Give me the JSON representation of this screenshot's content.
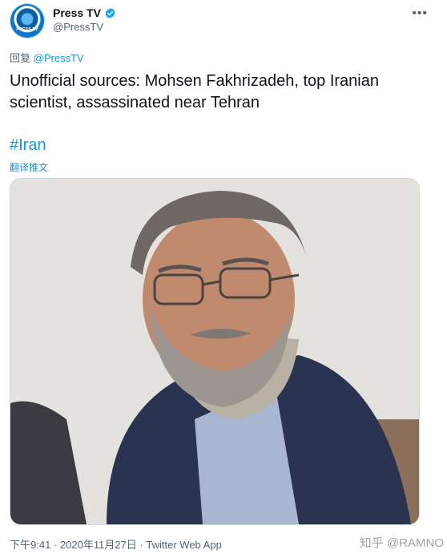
{
  "tweet": {
    "author": {
      "name": "Press TV",
      "handle": "@PressTV",
      "avatar_text": "PRESS TV",
      "verified_icon": "verified-badge-icon",
      "verified_color": "#1da1f2"
    },
    "more_icon": "more-options-icon",
    "reply_prefix": "回复",
    "reply_mention": "@PressTV",
    "text": "Unofficial sources: Mohsen Fakhrizadeh, top Iranian scientist, assassinated near Tehran",
    "hashtag": "#Iran",
    "translate_label": "翻译推文",
    "meta": {
      "time": "下午9:41",
      "separator": "·",
      "date": "2020年11月27日",
      "source": "Twitter Web App"
    }
  },
  "watermark": "知乎 @RAMNO",
  "colors": {
    "link": "#1b95e0",
    "text": "#0f1419",
    "secondary": "#536471"
  }
}
